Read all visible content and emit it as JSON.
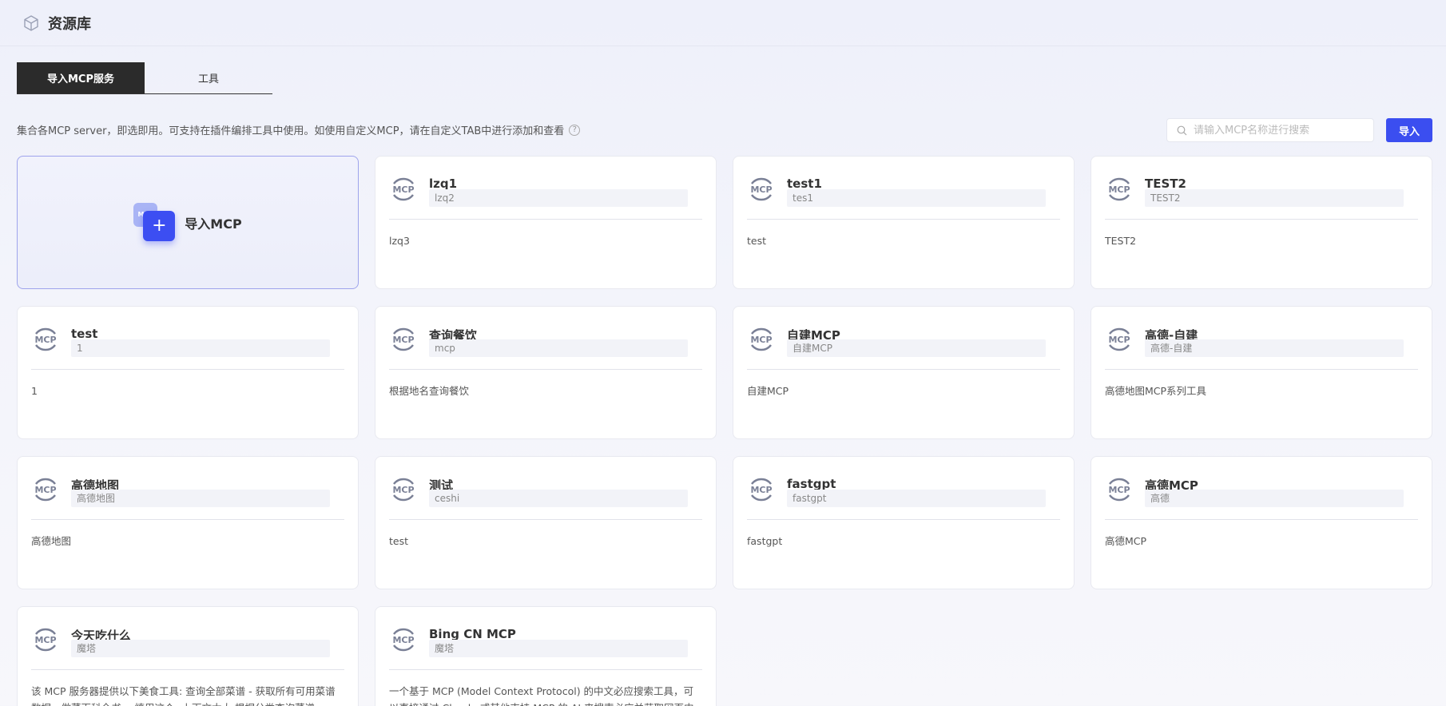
{
  "header": {
    "title": "资源库",
    "logo_icon": "cube-icon"
  },
  "tabs": [
    {
      "label": "导入MCP服务",
      "active": true
    },
    {
      "label": "工具",
      "active": false
    }
  ],
  "description": "集合各MCP server，即选即用。可支持在插件编排工具中使用。如使用自定义MCP，请在自定义TAB中进行添加和查看",
  "help_icon": "?",
  "search": {
    "placeholder": "请输入MCP名称进行搜索",
    "value": ""
  },
  "import_button": "导入",
  "import_card": {
    "label": "导入MCP",
    "badge": "MCP"
  },
  "mcp_logo_text": "MCP",
  "accent_color": "#3b4ef0",
  "cards": [
    {
      "name": "lzq1",
      "tag": "lzq2",
      "desc": "lzq3"
    },
    {
      "name": "test1",
      "tag": "tes1",
      "desc": "test"
    },
    {
      "name": "TEST2",
      "tag": "TEST2",
      "desc": "TEST2"
    },
    {
      "name": "test",
      "tag": "1",
      "desc": "1"
    },
    {
      "name": "查询餐饮",
      "tag": "mcp",
      "desc": "根据地名查询餐饮"
    },
    {
      "name": "自建MCP",
      "tag": "自建MCP",
      "desc": "自建MCP"
    },
    {
      "name": "高德-自建",
      "tag": "高德-自建",
      "desc": "高德地图MCP系列工具"
    },
    {
      "name": "高德地图",
      "tag": "高德地图",
      "desc": "高德地图"
    },
    {
      "name": "测试",
      "tag": "ceshi",
      "desc": "test"
    },
    {
      "name": "fastgpt",
      "tag": "fastgpt",
      "desc": "fastgpt"
    },
    {
      "name": "高德MCP",
      "tag": "高德",
      "desc": "高德MCP"
    },
    {
      "name": "今天吃什么",
      "tag": "魔塔",
      "desc": "该 MCP 服务器提供以下美食工具: 查询全部菜谱 - 获取所有可用菜谱数据，做菜百科全书 -- 慎用这个--上下文太大 根据分类查询菜谱 -"
    },
    {
      "name": "Bing CN MCP",
      "tag": "魔塔",
      "desc": "一个基于 MCP (Model Context Protocol) 的中文必应搜索工具，可以直接通过 Claude 或其他支持 MCP 的 AI 来搜索必应并获取网页内"
    }
  ]
}
